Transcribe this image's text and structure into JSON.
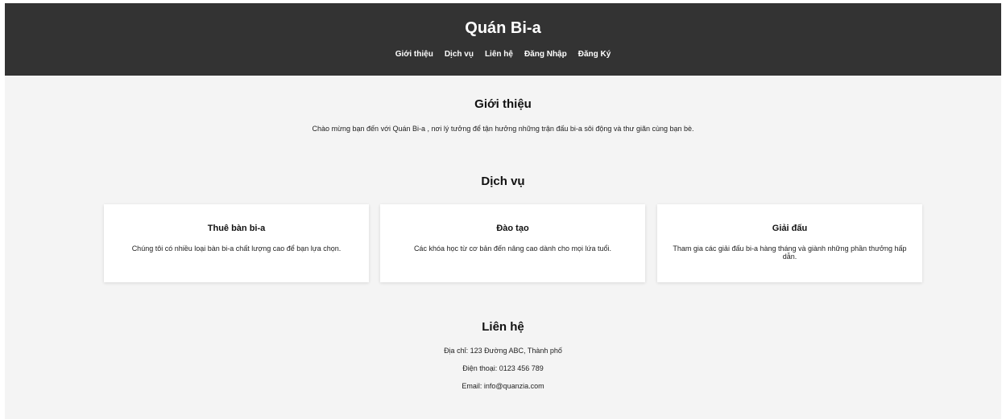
{
  "header": {
    "title": "Quán Bi-a",
    "nav": [
      "Giới thiệu",
      "Dịch vụ",
      "Liên hệ",
      "Đăng Nhập",
      "Đăng Ký"
    ]
  },
  "intro": {
    "heading": "Giới thiệu",
    "text": "Chào mừng bạn đến với Quán Bi-a , nơi lý tưởng để tận hưởng những trận đấu bi-a sôi động và thư giãn cùng bạn bè."
  },
  "services": {
    "heading": "Dịch vụ",
    "cards": [
      {
        "title": "Thuê bàn bi-a",
        "text": "Chúng tôi có nhiều loại bàn bi-a chất lượng cao để bạn lựa chọn."
      },
      {
        "title": "Đào tạo",
        "text": "Các khóa học từ cơ bản đến nâng cao dành cho mọi lứa tuổi."
      },
      {
        "title": "Giải đấu",
        "text": "Tham gia các giải đấu bi-a hàng tháng và giành những phần thưởng hấp dẫn."
      }
    ]
  },
  "contact": {
    "heading": "Liên hệ",
    "address": "Địa chỉ: 123 Đường ABC, Thành phố",
    "phone": "Điện thoại: 0123 456 789",
    "email": "Email: info@quanzia.com"
  },
  "colors": {
    "header_bg": "#333333",
    "page_bg": "#f4f4f4",
    "card_bg": "#ffffff"
  }
}
